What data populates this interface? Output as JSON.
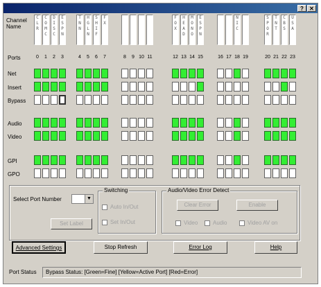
{
  "window": {
    "help_glyph": "?",
    "close_glyph": "✕"
  },
  "labels": {
    "channel_name": "Channel Name",
    "ports": "Ports",
    "net": "Net",
    "insert": "Insert",
    "bypass": "Bypass",
    "audio": "Audio",
    "video": "Video",
    "gpi": "GPI",
    "gpo": "GPO"
  },
  "ports": [
    "0",
    "1",
    "2",
    "3",
    "4",
    "5",
    "6",
    "7",
    "8",
    "9",
    "10",
    "11",
    "12",
    "13",
    "14",
    "15",
    "16",
    "17",
    "18",
    "19",
    "20",
    "21",
    "22",
    "23"
  ],
  "channel_names": [
    "C L R",
    "C O M C",
    "D I S C",
    "E S P N",
    "T N N",
    "H G L N",
    "S H I F",
    "F X",
    "",
    "",
    "",
    "",
    "F O X",
    "H E A D",
    "M O N O",
    "E S P N",
    "",
    "",
    "N I C",
    "",
    "S P O R",
    "T N T",
    "C B S",
    "U S A"
  ],
  "rows": {
    "net": [
      1,
      1,
      1,
      1,
      1,
      1,
      1,
      1,
      0,
      0,
      0,
      0,
      1,
      1,
      1,
      1,
      0,
      0,
      1,
      0,
      1,
      1,
      1,
      1
    ],
    "insert": [
      1,
      1,
      1,
      1,
      1,
      1,
      1,
      1,
      0,
      0,
      0,
      0,
      0,
      0,
      0,
      1,
      0,
      0,
      0,
      0,
      0,
      0,
      1,
      0
    ],
    "bypass": [
      0,
      0,
      0,
      0,
      0,
      0,
      0,
      0,
      0,
      0,
      0,
      0,
      0,
      0,
      0,
      0,
      0,
      0,
      0,
      0,
      0,
      0,
      0,
      0
    ],
    "audio": [
      1,
      1,
      1,
      1,
      1,
      1,
      1,
      1,
      0,
      0,
      0,
      0,
      1,
      1,
      1,
      1,
      0,
      0,
      1,
      0,
      1,
      1,
      1,
      1
    ],
    "video": [
      1,
      1,
      1,
      1,
      1,
      1,
      1,
      1,
      0,
      0,
      0,
      0,
      1,
      1,
      1,
      1,
      0,
      0,
      1,
      0,
      1,
      1,
      1,
      1
    ],
    "gpi": [
      1,
      1,
      1,
      1,
      1,
      1,
      1,
      1,
      0,
      0,
      0,
      0,
      1,
      1,
      1,
      1,
      0,
      0,
      1,
      0,
      1,
      1,
      1,
      1
    ],
    "gpo": [
      0,
      0,
      0,
      0,
      0,
      0,
      0,
      0,
      0,
      0,
      0,
      0,
      0,
      0,
      0,
      0,
      0,
      0,
      0,
      0,
      0,
      0,
      0,
      0
    ]
  },
  "bypass_highlight_port": 3,
  "controls": {
    "select_port_label": "Select Port Number",
    "select_port_value": "",
    "set_label_button": "Set Label",
    "switching_title": "Switching",
    "switching_opt1": "Auto In/Out",
    "switching_opt2": "Set In/Out",
    "av_error_title": "Audio/Video Error Detect",
    "error_button1": "Clear Error",
    "error_button2": "Enable",
    "chk_video": "Video",
    "chk_audio": "Audio",
    "chk_video_av": "Video AV on"
  },
  "buttons": {
    "advanced": "Advanced Settings",
    "stop_refresh": "Stop Refresh",
    "error_log": "Error Log",
    "help": "Help"
  },
  "status": {
    "label": "Port Status",
    "text": "Bypass Status: [Green=Fine] [Yellow=Active Port] [Red=Error]"
  },
  "colors": {
    "active": "#33ee33",
    "inactive": "#ffffff",
    "titlebar": "#0a246a"
  }
}
